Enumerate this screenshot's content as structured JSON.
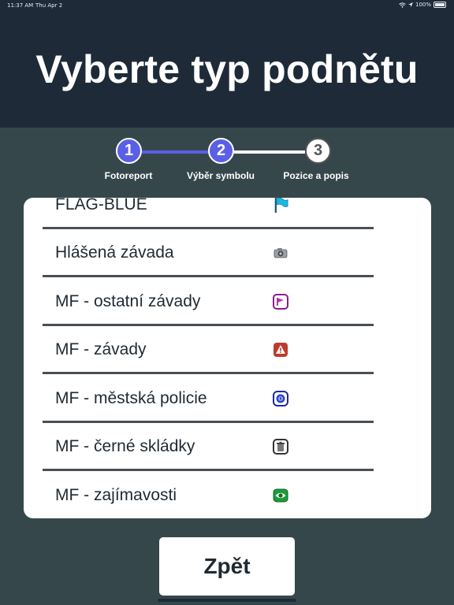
{
  "statusbar": {
    "time": "11:37 AM",
    "date": "Thu Apr 2",
    "battery": "100%"
  },
  "header": {
    "title": "Vyberte typ podnětu"
  },
  "stepper": {
    "steps": [
      {
        "number": "1",
        "label": "Fotoreport",
        "state": "done"
      },
      {
        "number": "2",
        "label": "Výběr symbolu",
        "state": "done"
      },
      {
        "number": "3",
        "label": "Pozice a popis",
        "state": "todo"
      }
    ],
    "active_color": "#5b5fe6"
  },
  "symbols": [
    {
      "label": "FLAG-BLUE",
      "icon": "blue-flag-icon"
    },
    {
      "label": "Hlášená závada",
      "icon": "camera-icon"
    },
    {
      "label": "MF - ostatní závady",
      "icon": "purple-flag-icon"
    },
    {
      "label": "MF - závady",
      "icon": "warning-icon"
    },
    {
      "label": "MF - městská policie",
      "icon": "police-icon"
    },
    {
      "label": "MF - černé skládky",
      "icon": "trash-icon"
    },
    {
      "label": "MF - zajímavosti",
      "icon": "eye-icon"
    }
  ],
  "footer": {
    "back_label": "Zpět"
  }
}
